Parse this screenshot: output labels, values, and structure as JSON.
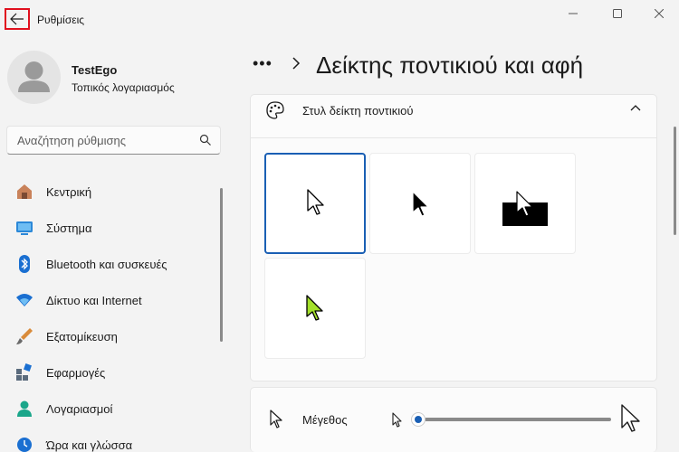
{
  "window": {
    "title": "Ρυθμίσεις",
    "minimize_icon": "minimize-icon",
    "maximize_icon": "maximize-icon",
    "close_icon": "close-icon"
  },
  "profile": {
    "name": "TestEgo",
    "account_type": "Τοπικός λογαριασμός"
  },
  "search": {
    "placeholder": "Αναζήτηση ρύθμισης"
  },
  "sidebar": {
    "items": [
      {
        "label": "Κεντρική",
        "icon": "home-icon"
      },
      {
        "label": "Σύστημα",
        "icon": "system-icon"
      },
      {
        "label": "Bluetooth και συσκευές",
        "icon": "bluetooth-icon"
      },
      {
        "label": "Δίκτυο και Internet",
        "icon": "wifi-icon"
      },
      {
        "label": "Εξατομίκευση",
        "icon": "brush-icon"
      },
      {
        "label": "Εφαρμογές",
        "icon": "apps-icon"
      },
      {
        "label": "Λογαριασμοί",
        "icon": "account-icon"
      },
      {
        "label": "Ώρα και γλώσσα",
        "icon": "time-language-icon"
      }
    ]
  },
  "header": {
    "breadcrumb_more": "•••",
    "title": "Δείκτης ποντικιού και αφή"
  },
  "pointer_style": {
    "title": "Στυλ δείκτη ποντικιού",
    "options": [
      {
        "name": "white",
        "selected": true
      },
      {
        "name": "black",
        "selected": false
      },
      {
        "name": "inverted",
        "selected": false
      },
      {
        "name": "custom-lime",
        "selected": false
      }
    ],
    "accent_color": "#1a5fb4",
    "custom_color": "#a3e02a"
  },
  "size": {
    "label": "Μέγεθος",
    "value_fraction": 0.0
  }
}
